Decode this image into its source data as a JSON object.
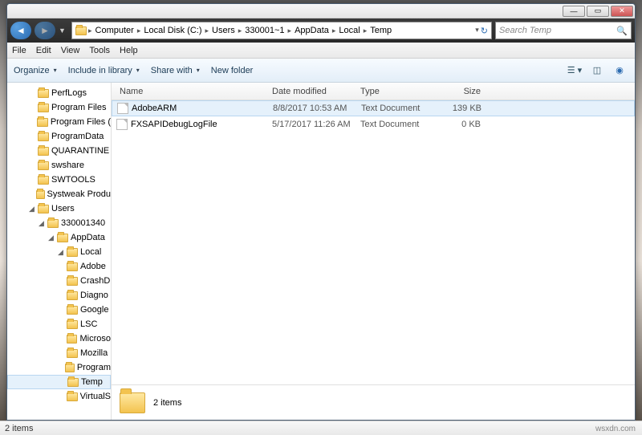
{
  "titlebar": {
    "min": "—",
    "max": "▭",
    "close": "✕"
  },
  "breadcrumb": [
    "Computer",
    "Local Disk (C:)",
    "Users",
    "330001~1",
    "AppData",
    "Local",
    "Temp"
  ],
  "search": {
    "placeholder": "Search Temp"
  },
  "menu": {
    "file": "File",
    "edit": "Edit",
    "view": "View",
    "tools": "Tools",
    "help": "Help"
  },
  "toolbar": {
    "organize": "Organize",
    "include": "Include in library",
    "share": "Share with",
    "newfolder": "New folder"
  },
  "columns": {
    "name": "Name",
    "date": "Date modified",
    "type": "Type",
    "size": "Size"
  },
  "tree": [
    {
      "ind": 0,
      "label": "PerfLogs"
    },
    {
      "ind": 0,
      "label": "Program Files"
    },
    {
      "ind": 0,
      "label": "Program Files ("
    },
    {
      "ind": 0,
      "label": "ProgramData"
    },
    {
      "ind": 0,
      "label": "QUARANTINE"
    },
    {
      "ind": 0,
      "label": "swshare"
    },
    {
      "ind": 0,
      "label": "SWTOOLS"
    },
    {
      "ind": 0,
      "label": "Systweak Produ"
    },
    {
      "ind": 0,
      "label": "Users",
      "tw": "◢"
    },
    {
      "ind": 1,
      "label": "330001340",
      "tw": "◢"
    },
    {
      "ind": 2,
      "label": "AppData",
      "tw": "◢"
    },
    {
      "ind": 3,
      "label": "Local",
      "tw": "◢"
    },
    {
      "ind": 4,
      "label": "Adobe"
    },
    {
      "ind": 4,
      "label": "CrashD"
    },
    {
      "ind": 4,
      "label": "Diagno"
    },
    {
      "ind": 4,
      "label": "Google"
    },
    {
      "ind": 4,
      "label": "LSC"
    },
    {
      "ind": 4,
      "label": "Microso"
    },
    {
      "ind": 4,
      "label": "Mozilla"
    },
    {
      "ind": 4,
      "label": "Program"
    },
    {
      "ind": 4,
      "label": "Temp",
      "sel": true
    },
    {
      "ind": 4,
      "label": "VirtualS"
    }
  ],
  "files": [
    {
      "name": "AdobeARM",
      "date": "8/8/2017 10:53 AM",
      "type": "Text Document",
      "size": "139 KB",
      "sel": true
    },
    {
      "name": "FXSAPIDebugLogFile",
      "date": "5/17/2017 11:26 AM",
      "type": "Text Document",
      "size": "0 KB"
    }
  ],
  "details": {
    "count": "2 items"
  },
  "status": {
    "left": "2 items",
    "right": "wsxdn.com"
  }
}
